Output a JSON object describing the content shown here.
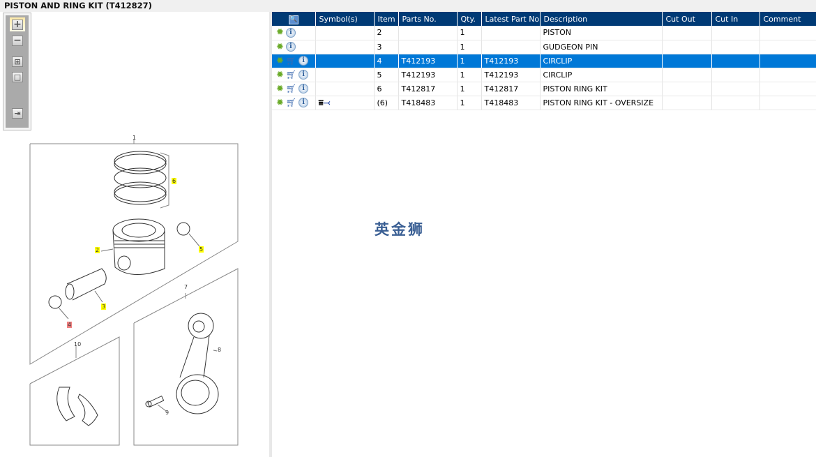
{
  "title": "PISTON AND RING KIT (T412827)",
  "toolbar": [
    {
      "name": "zoom-in",
      "glyph": "+"
    },
    {
      "name": "zoom-out",
      "glyph": "−"
    },
    {
      "name": "fit-all",
      "glyph": "⊞"
    },
    {
      "name": "actual-size",
      "glyph": "□"
    },
    {
      "name": "export",
      "glyph": "⇥"
    }
  ],
  "columns": [
    "",
    "Symbol(s)",
    "Item",
    "Parts No.",
    "Qty.",
    "Latest Part No.",
    "Description",
    "Cut Out",
    "Cut In",
    "Comment"
  ],
  "rows": [
    {
      "item": "2",
      "part": "",
      "qty": "1",
      "latest": "",
      "desc": "PISTON",
      "cart": false,
      "symbol": false
    },
    {
      "item": "3",
      "part": "",
      "qty": "1",
      "latest": "",
      "desc": "GUDGEON PIN",
      "cart": false,
      "symbol": false
    },
    {
      "item": "4",
      "part": "T412193",
      "qty": "1",
      "latest": "T412193",
      "desc": "CIRCLIP",
      "cart": true,
      "symbol": false,
      "selected": true
    },
    {
      "item": "5",
      "part": "T412193",
      "qty": "1",
      "latest": "T412193",
      "desc": "CIRCLIP",
      "cart": true,
      "symbol": false
    },
    {
      "item": "6",
      "part": "T412817",
      "qty": "1",
      "latest": "T412817",
      "desc": "PISTON RING KIT",
      "cart": true,
      "symbol": false
    },
    {
      "item": "(6)",
      "part": "T418483",
      "qty": "1",
      "latest": "T418483",
      "desc": "PISTON RING KIT - OVERSIZE",
      "cart": true,
      "symbol": true
    }
  ],
  "watermark": "英金狮",
  "callouts": [
    "1",
    "2",
    "3",
    "4",
    "5",
    "6",
    "7",
    "8",
    "9",
    "10"
  ],
  "colors": {
    "header": "#003a75",
    "selected": "#0078d7",
    "highlight": "#ffff00",
    "selected_callout": "#f08080"
  }
}
